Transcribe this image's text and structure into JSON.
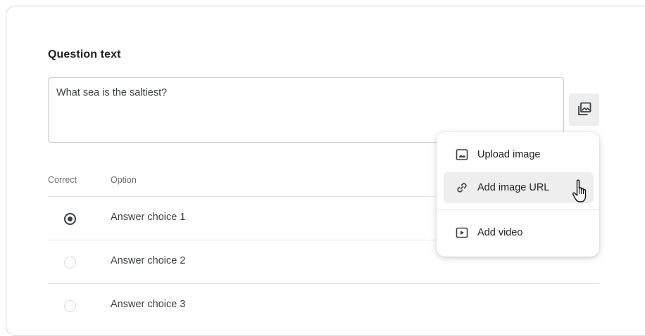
{
  "question": {
    "section_label": "Question text",
    "value": "What sea is the saltiest?"
  },
  "media_button": {
    "icon": "image-gallery-icon"
  },
  "media_menu": {
    "items": [
      {
        "label": "Upload image",
        "icon": "image-icon"
      },
      {
        "label": "Add image URL",
        "icon": "link-icon"
      },
      {
        "label": "Add video",
        "icon": "video-play-icon"
      }
    ]
  },
  "options_table": {
    "headers": {
      "correct": "Correct",
      "option": "Option"
    },
    "rows": [
      {
        "label": "Answer choice 1",
        "correct": true
      },
      {
        "label": "Answer choice 2",
        "correct": false
      },
      {
        "label": "Answer choice 3",
        "correct": false
      }
    ]
  },
  "colors": {
    "text": "#202124",
    "muted": "#6a6c70",
    "border": "#dadce0",
    "hover": "#eeeeee"
  }
}
